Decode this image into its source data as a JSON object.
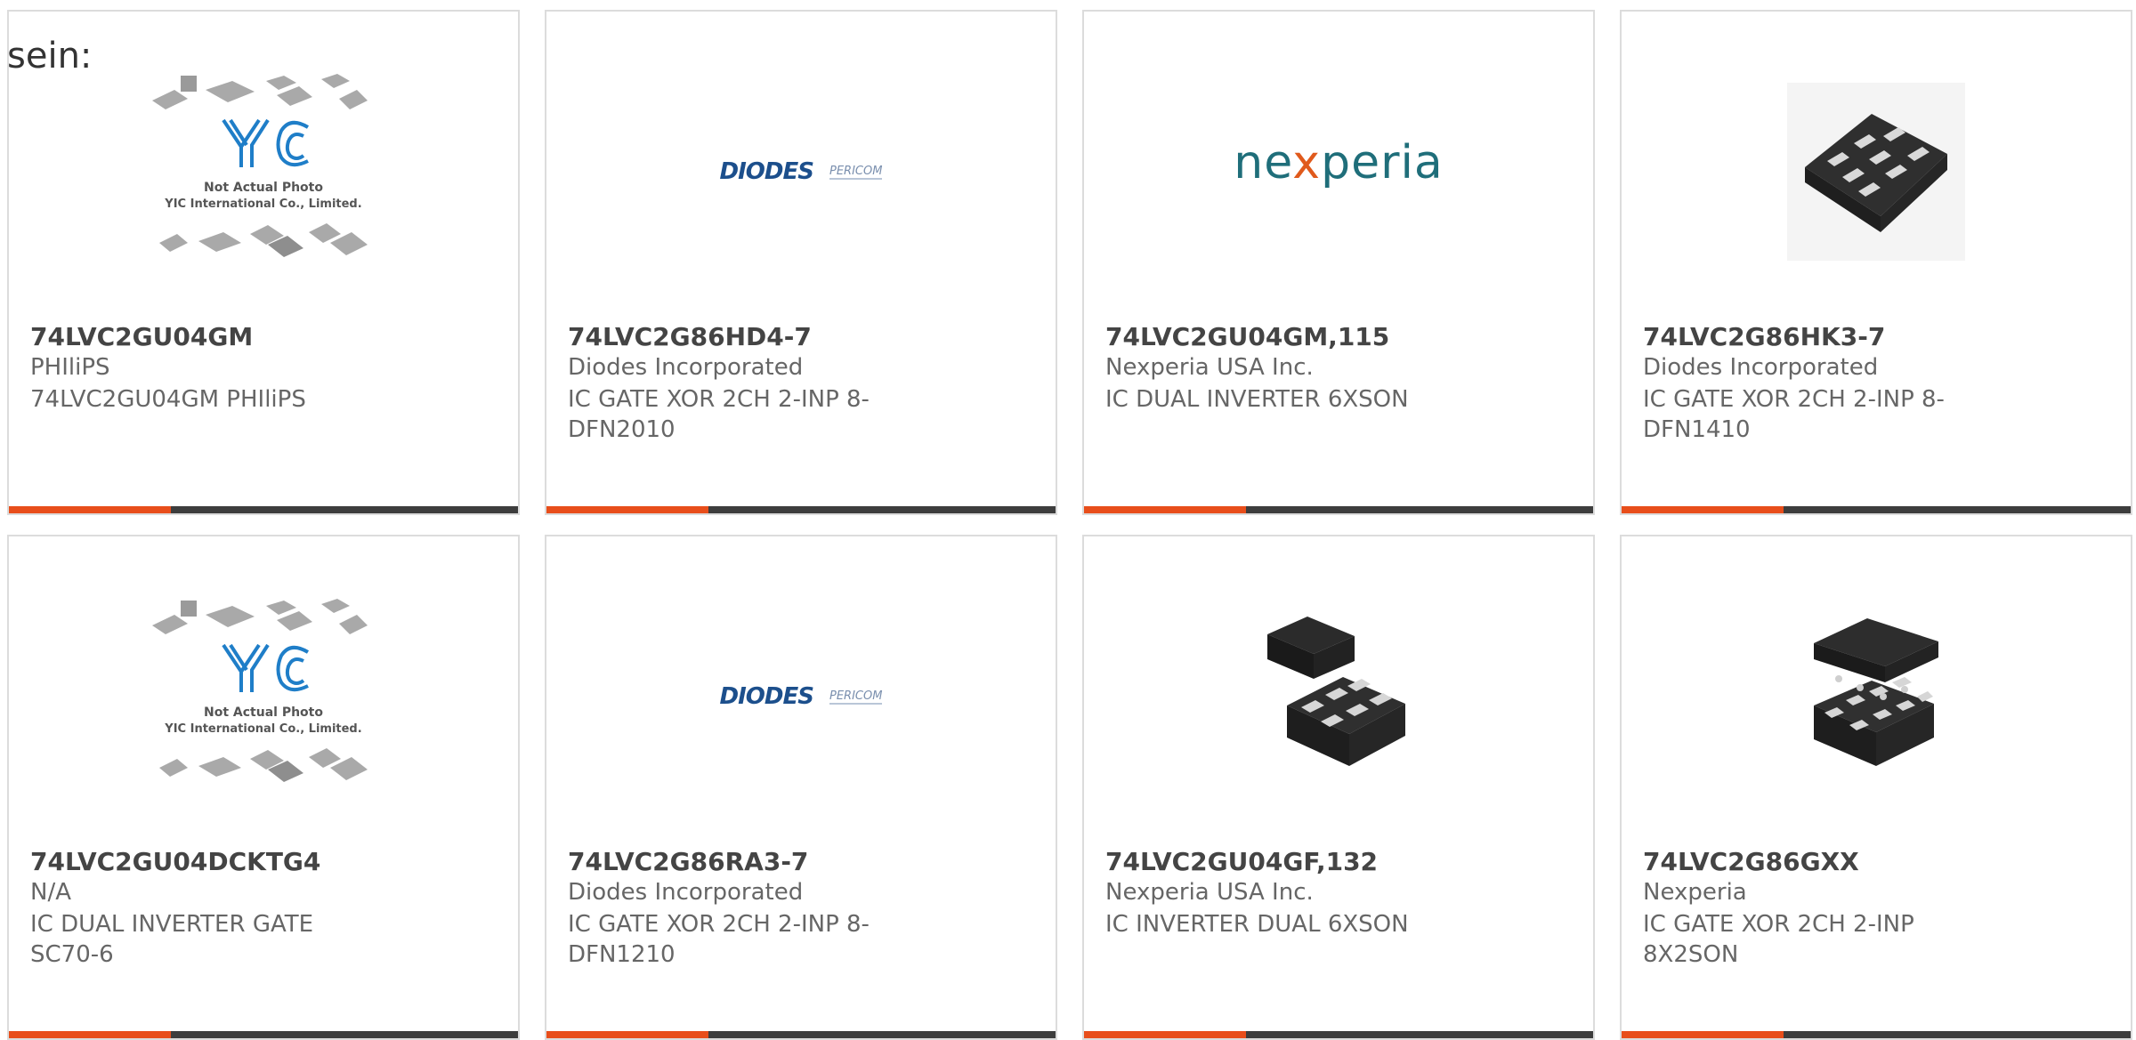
{
  "page": {
    "top_label": "sein:"
  },
  "cards": [
    {
      "part_number": "74LVC2GU04GM",
      "manufacturer": "PHIliPS",
      "description": "74LVC2GU04GM PHIliPS",
      "image": "yic-placeholder",
      "placeholder_text_1": "Not Actual Photo",
      "placeholder_text_2": "YIC International Co., Limited."
    },
    {
      "part_number": "74LVC2G86HD4-7",
      "manufacturer": "Diodes Incorporated",
      "description": "IC GATE XOR 2CH 2-INP 8-DFN2010",
      "image": "diodes-logo",
      "logo_main": "DIODES",
      "logo_secondary": "PERICOM"
    },
    {
      "part_number": "74LVC2GU04GM,115",
      "manufacturer": "Nexperia USA Inc.",
      "description": "IC DUAL INVERTER 6XSON",
      "image": "nexperia-logo"
    },
    {
      "part_number": "74LVC2G86HK3-7",
      "manufacturer": "Diodes Incorporated",
      "description": "IC GATE XOR 2CH 2-INP 8-DFN1410",
      "image": "chip-8pad"
    },
    {
      "part_number": "74LVC2GU04DCKTG4",
      "manufacturer": "N/A",
      "description": "IC DUAL INVERTER GATE SC70-6",
      "image": "yic-placeholder",
      "placeholder_text_1": "Not Actual Photo",
      "placeholder_text_2": "YIC International Co., Limited."
    },
    {
      "part_number": "74LVC2G86RA3-7",
      "manufacturer": "Diodes Incorporated",
      "description": "IC GATE XOR 2CH 2-INP 8-DFN1210",
      "image": "diodes-logo",
      "logo_main": "DIODES",
      "logo_secondary": "PERICOM"
    },
    {
      "part_number": "74LVC2GU04GF,132",
      "manufacturer": "Nexperia USA Inc.",
      "description": "IC INVERTER DUAL 6XSON",
      "image": "chip-6pad-pair"
    },
    {
      "part_number": "74LVC2G86GXX",
      "manufacturer": "Nexperia",
      "description": "IC GATE XOR 2CH 2-INP 8X2SON",
      "image": "chip-8pad-pair"
    }
  ],
  "colors": {
    "accent": "#e84e1b",
    "bar": "#3d3d3d",
    "border": "#dcdcdc",
    "yic_blue": "#1f7ec8"
  }
}
